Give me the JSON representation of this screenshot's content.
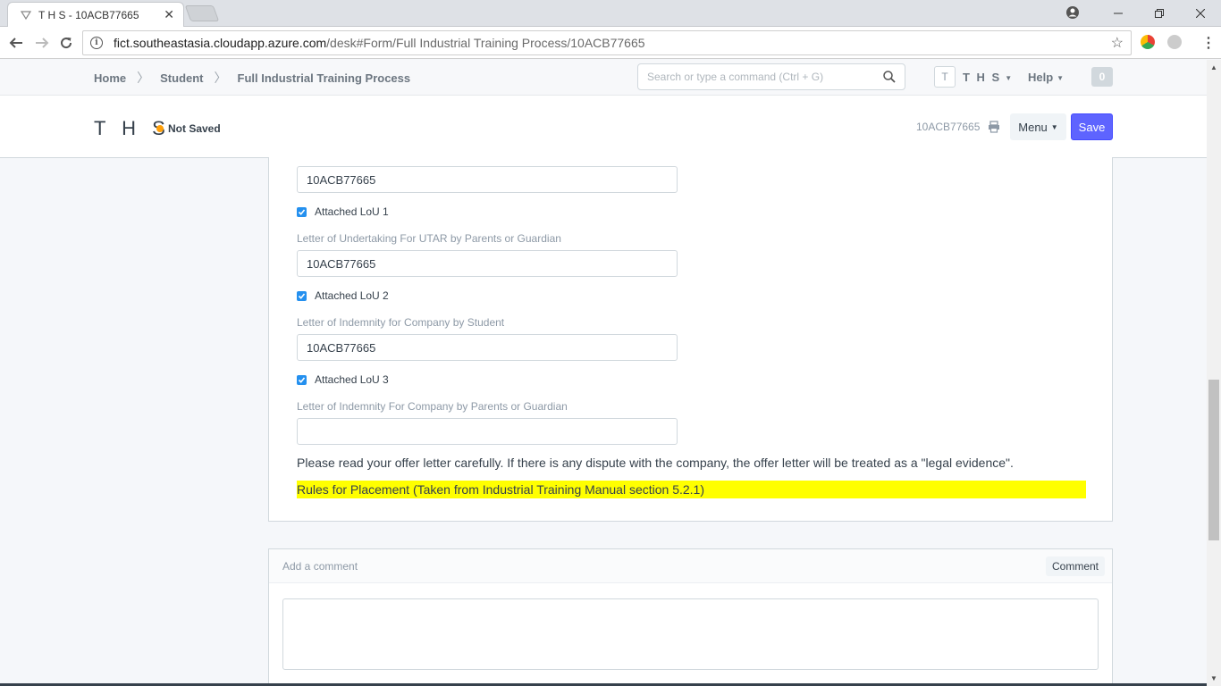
{
  "browser": {
    "tab_title": "T H S - 10ACB77665",
    "url_host": "fict.southeastasia.cloudapp.azure.com",
    "url_path": "/desk#Form/Full Industrial Training Process/10ACB77665"
  },
  "navbar": {
    "breadcrumbs": [
      "Home",
      "Student",
      "Full Industrial Training Process"
    ],
    "search_placeholder": "Search or type a command (Ctrl + G)",
    "avatar_letter": "T",
    "user_label": "T H S",
    "help_label": "Help",
    "notification_count": "0"
  },
  "page_head": {
    "title": "T H S",
    "status": "Not Saved",
    "doc_name": "10ACB77665",
    "menu_label": "Menu",
    "save_label": "Save"
  },
  "form": {
    "field_top_value": "10ACB77665",
    "check1_label": "Attached LoU 1",
    "label2": "Letter of Undertaking For UTAR by Parents or Guardian",
    "field2_value": "10ACB77665",
    "check2_label": "Attached LoU 2",
    "label3": "Letter of Indemnity for Company by Student",
    "field3_value": "10ACB77665",
    "check3_label": "Attached LoU 3",
    "label4": "Letter of Indemnity For Company by Parents or Guardian",
    "field4_value": "",
    "note": "Please read your offer letter carefully. If there is any dispute with the company, the offer letter will be treated as a \"legal evidence\".",
    "highlight": "Rules for Placement (Taken from Industrial Training Manual section 5.2.1)"
  },
  "comment": {
    "title": "Add a comment",
    "button_label": "Comment"
  },
  "colors": {
    "primary": "#5e64ff",
    "indicator_orange": "#ffa00a",
    "checkbox_blue": "#2490ef",
    "highlight_yellow": "#ffff00"
  }
}
